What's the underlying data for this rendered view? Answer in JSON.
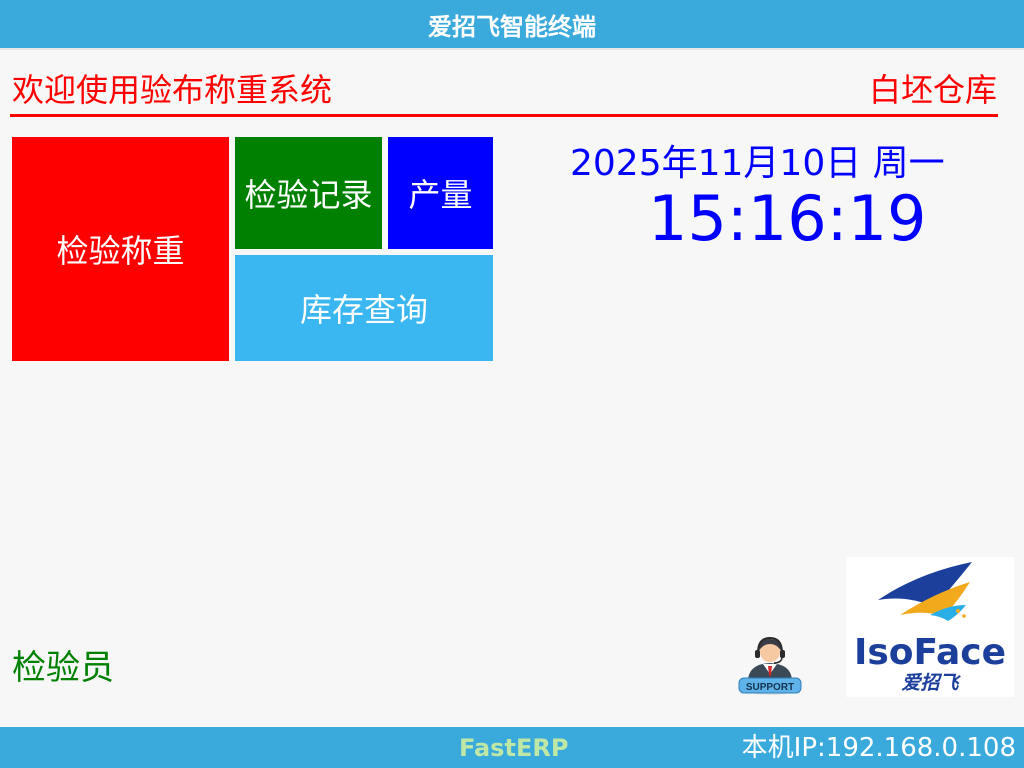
{
  "window": {
    "title": "爱招飞智能终端"
  },
  "header": {
    "welcome": "欢迎使用验布称重系统",
    "warehouse": "白坯仓库"
  },
  "colors": {
    "title_bar": "#3aa9dc",
    "accent_red": "#ff0000",
    "tile_weigh": "#ff0000",
    "tile_records": "#008000",
    "tile_output": "#0000ff",
    "tile_stock": "#3ab7f0",
    "clock_blue": "#0000ff",
    "inspector_green": "#008000",
    "brand_green": "#bfe7a6"
  },
  "tiles": {
    "weigh": "检验称重",
    "records": "检验记录",
    "output": "产量",
    "stock": "库存查询"
  },
  "clock": {
    "date": "2025年11月10日 周一",
    "time": "15:16:19"
  },
  "user": {
    "role": "检验员"
  },
  "support": {
    "label": "SUPPORT",
    "icon": "support-agent-icon"
  },
  "logo": {
    "brand": "IsoFace",
    "chinese": "爱招飞",
    "icon": "isoface-logo"
  },
  "footer": {
    "brand": "FastERP",
    "ip": "本机IP:192.168.0.108"
  }
}
